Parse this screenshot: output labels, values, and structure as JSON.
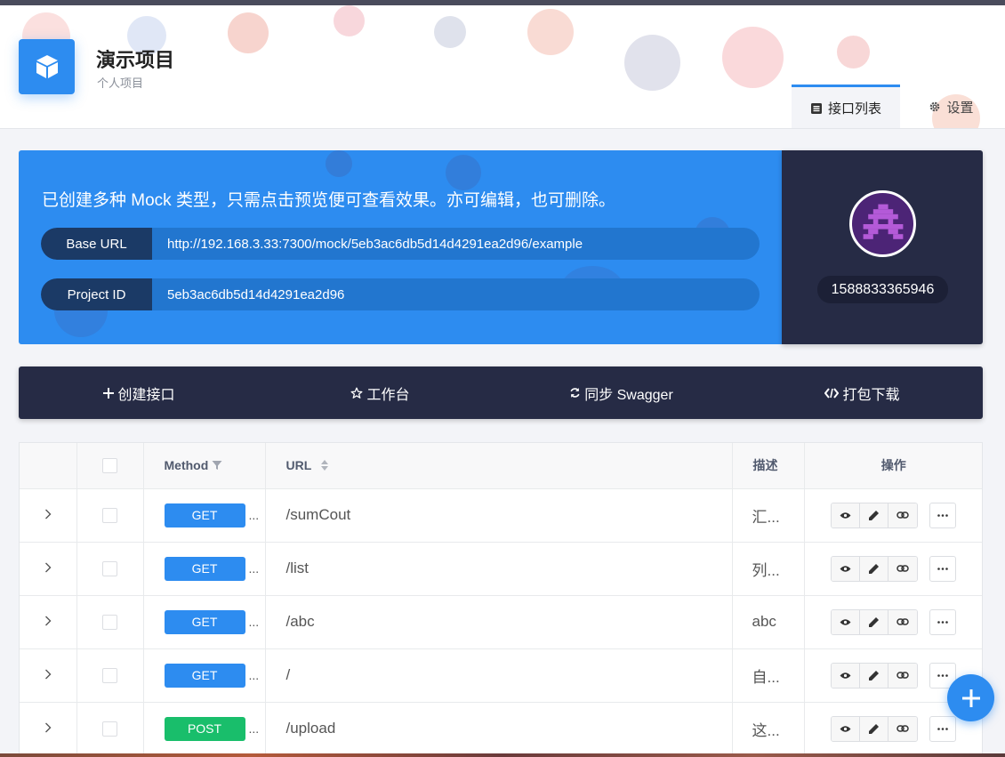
{
  "header": {
    "project_title": "演示项目",
    "project_subtitle": "个人项目",
    "tabs": [
      {
        "label": "接口列表",
        "icon": "list-icon",
        "active": true
      },
      {
        "label": "设置",
        "icon": "gear-icon",
        "active": false
      }
    ]
  },
  "info": {
    "message": "已创建多种 Mock 类型，只需点击预览便可查看效果。亦可编辑，也可删除。",
    "base_url_label": "Base URL",
    "base_url_value": "http://192.168.3.33:7300/mock/5eb3ac6db5d14d4291ea2d96/example",
    "project_id_label": "Project ID",
    "project_id_value": "5eb3ac6db5d14d4291ea2d96"
  },
  "user": {
    "name": "1588833365946"
  },
  "actions": [
    {
      "label": "创建接口",
      "icon": "plus-icon"
    },
    {
      "label": "工作台",
      "icon": "star-icon"
    },
    {
      "label": "同步 Swagger",
      "icon": "sync-icon"
    },
    {
      "label": "打包下载",
      "icon": "code-icon"
    }
  ],
  "table": {
    "columns": {
      "method": "Method",
      "url": "URL",
      "desc": "描述",
      "ops": "操作"
    },
    "rows": [
      {
        "method": "GET",
        "url": "/sumCout",
        "desc": "汇..."
      },
      {
        "method": "GET",
        "url": "/list",
        "desc": "列..."
      },
      {
        "method": "GET",
        "url": "/abc",
        "desc": "abc"
      },
      {
        "method": "GET",
        "url": "/",
        "desc": "自..."
      },
      {
        "method": "POST",
        "url": "/upload",
        "desc": "这..."
      }
    ]
  },
  "colors": {
    "primary": "#2d8cf0",
    "dark": "#262b45",
    "get": "#2d8cf0",
    "post": "#19be6b"
  }
}
